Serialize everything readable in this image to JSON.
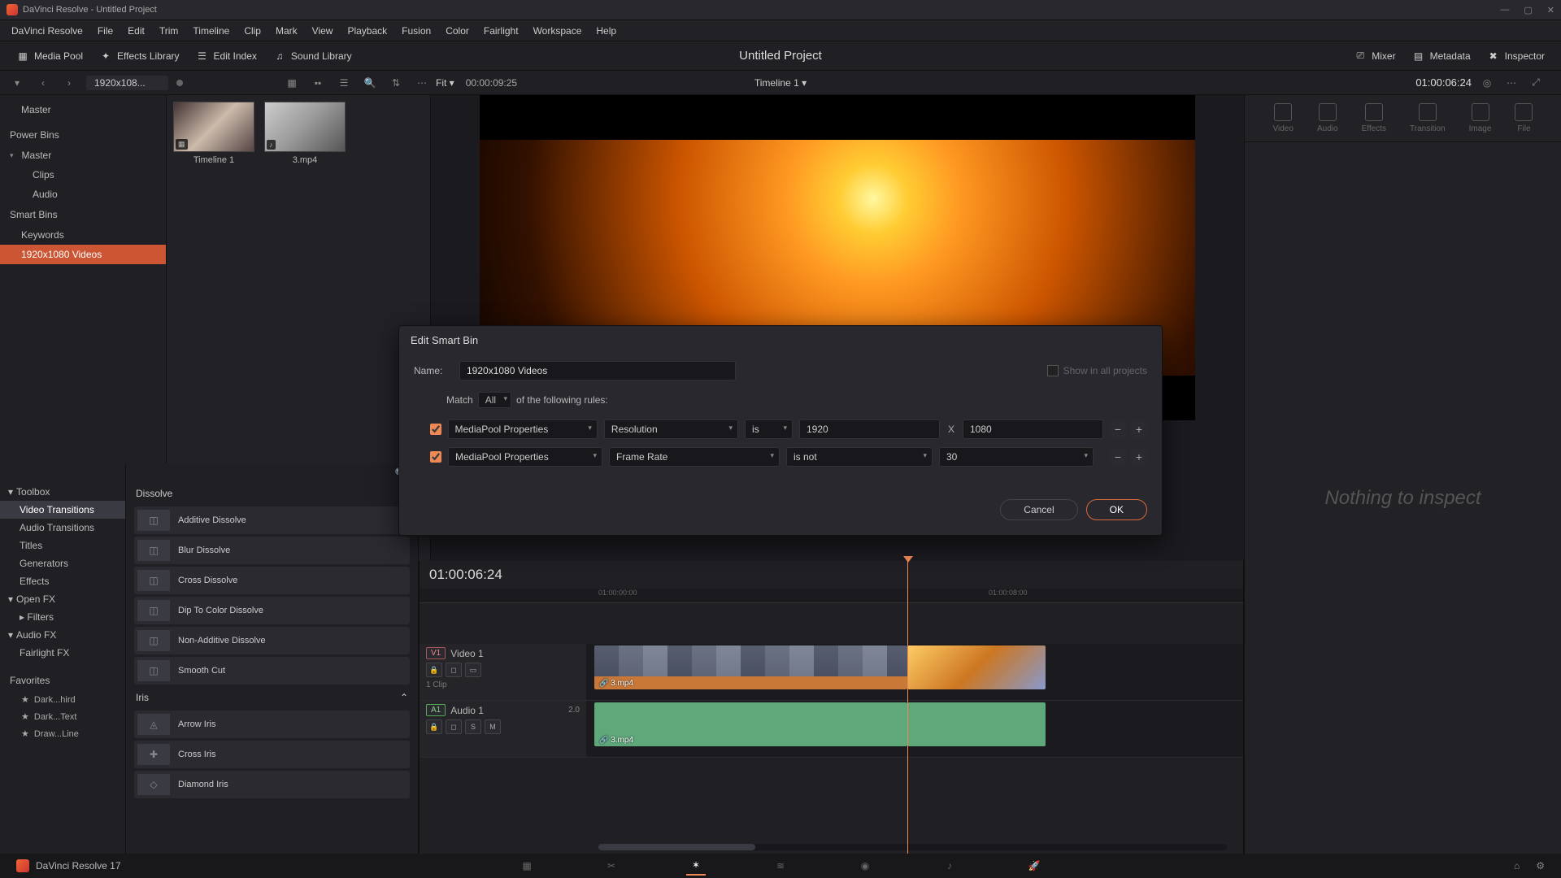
{
  "titlebar": "DaVinci Resolve - Untitled Project",
  "menu": [
    "DaVinci Resolve",
    "File",
    "Edit",
    "Trim",
    "Timeline",
    "Clip",
    "Mark",
    "View",
    "Playback",
    "Fusion",
    "Color",
    "Fairlight",
    "Workspace",
    "Help"
  ],
  "toolbar": {
    "media_pool": "Media Pool",
    "effects_lib": "Effects Library",
    "edit_index": "Edit Index",
    "sound_lib": "Sound Library",
    "mixer": "Mixer",
    "metadata": "Metadata",
    "inspector": "Inspector"
  },
  "project_title": "Untitled Project",
  "subbar": {
    "bin_name": "1920x108...",
    "fit": "Fit",
    "timecode_left": "00:00:09:25",
    "timeline_name": "Timeline 1",
    "timecode_right": "01:00:06:24"
  },
  "bins": {
    "master": "Master",
    "power_bins": "Power Bins",
    "power_items": [
      "Master",
      "Clips",
      "Audio"
    ],
    "smart_bins": "Smart Bins",
    "smart_items": [
      "Keywords",
      "1920x1080 Videos"
    ]
  },
  "pool": {
    "thumbs": [
      {
        "label": "Timeline 1",
        "badge": "▦"
      },
      {
        "label": "3.mp4",
        "badge": "♪"
      }
    ]
  },
  "inspector_tabs": [
    "Video",
    "Audio",
    "Effects",
    "Transition",
    "Image",
    "File"
  ],
  "inspector_empty": "Nothing to inspect",
  "fx": {
    "toolbox": "Toolbox",
    "tree": [
      "Video Transitions",
      "Audio Transitions",
      "Titles",
      "Generators",
      "Effects"
    ],
    "open_fx": "Open FX",
    "filters": "Filters",
    "audio_fx": "Audio FX",
    "fairlight": "Fairlight FX",
    "favorites": "Favorites",
    "fav_items": [
      "Dark...hird",
      "Dark...Text",
      "Draw...Line"
    ],
    "group1": "Dissolve",
    "items1": [
      "Additive Dissolve",
      "Blur Dissolve",
      "Cross Dissolve",
      "Dip To Color Dissolve",
      "Non-Additive Dissolve",
      "Smooth Cut"
    ],
    "group2": "Iris",
    "items2": [
      "Arrow Iris",
      "Cross Iris",
      "Diamond Iris"
    ]
  },
  "timeline": {
    "tc": "01:00:06:24",
    "ticks": [
      "01:00:00:00",
      "01:00:08:00"
    ],
    "v1_badge": "V1",
    "v1_name": "Video 1",
    "v1_clip_info": "1 Clip",
    "a1_badge": "A1",
    "a1_name": "Audio 1",
    "a1_meter": "2.0",
    "clip_name": "3.mp4",
    "controls": {
      "lock": "🔒",
      "auto": "◻",
      "solo": "S",
      "mute": "M"
    }
  },
  "dialog": {
    "title": "Edit Smart Bin",
    "name_label": "Name:",
    "name_value": "1920x1080 Videos",
    "show_all": "Show in all projects",
    "match": "Match",
    "match_val": "All",
    "match_suffix": "of the following rules:",
    "rules": [
      {
        "cat": "MediaPool Properties",
        "field": "Resolution",
        "op": "is",
        "v1": "1920",
        "x": "X",
        "v2": "1080"
      },
      {
        "cat": "MediaPool Properties",
        "field": "Frame Rate",
        "op": "is not",
        "v1": "30"
      }
    ],
    "cancel": "Cancel",
    "ok": "OK"
  },
  "pagebar": {
    "app": "DaVinci Resolve 17"
  }
}
